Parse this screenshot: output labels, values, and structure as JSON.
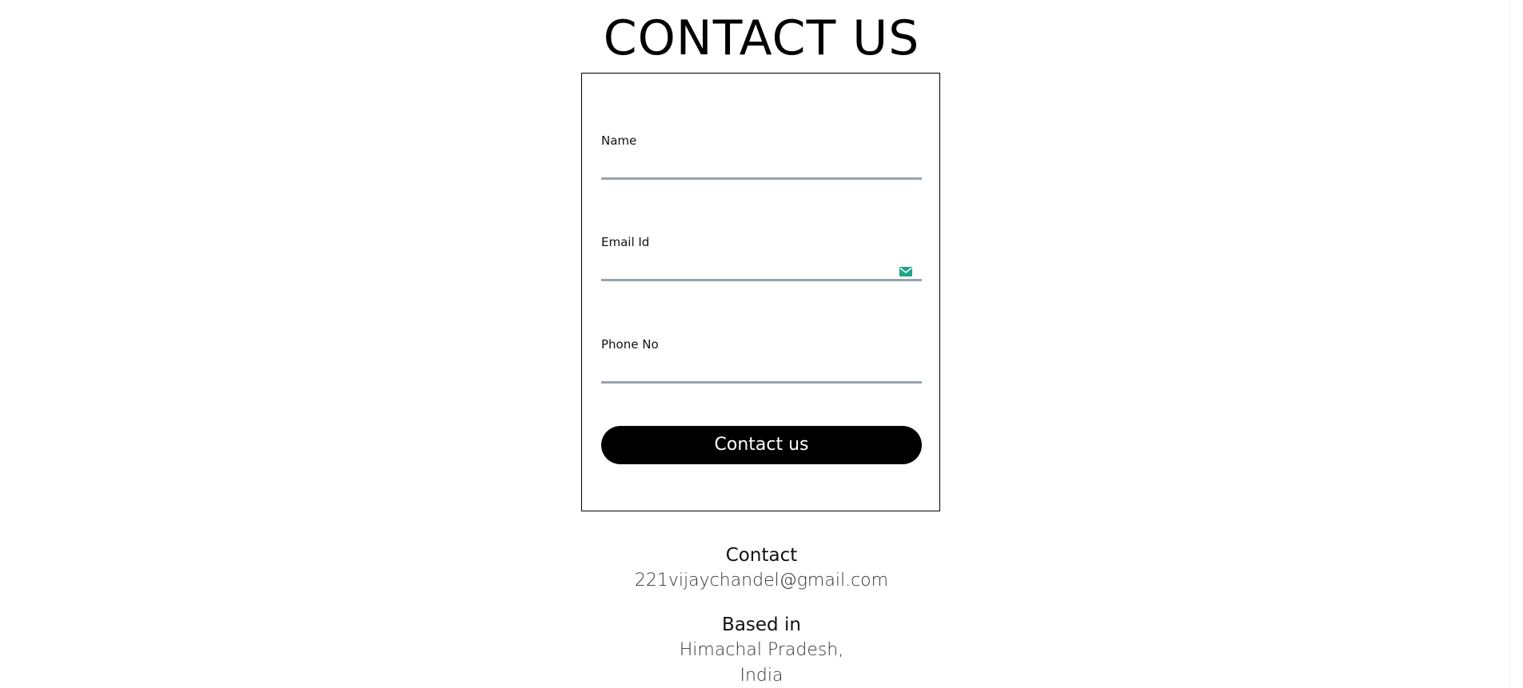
{
  "page": {
    "title": "CONTACT US"
  },
  "form": {
    "fields": [
      {
        "label": "Name",
        "value": "",
        "placeholder": ""
      },
      {
        "label": "Email Id",
        "value": "",
        "placeholder": ""
      },
      {
        "label": "Phone No",
        "value": "",
        "placeholder": ""
      }
    ],
    "email_icon": "mail-icon",
    "submit_label": "Contact us"
  },
  "contact": {
    "heading": "Contact",
    "email": "221vijaychandel@gmail.com"
  },
  "location": {
    "heading": "Based in",
    "line1": "Himachal Pradesh,",
    "line2": "India"
  },
  "colors": {
    "accent_icon": "#1fa58a",
    "input_underline": "#9aa3ad",
    "button_bg": "#000000",
    "button_text": "#ffffff"
  }
}
